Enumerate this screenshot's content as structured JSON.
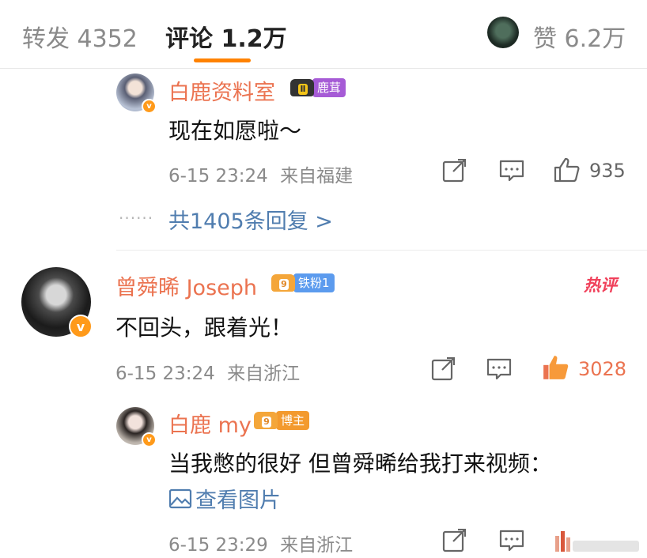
{
  "tabs": {
    "forward_label": "转发 4352",
    "comments_label": "评论 1.2万",
    "likes_label": "赞 6.2万"
  },
  "colors": {
    "accent": "#ff8200",
    "username": "#eb7350",
    "link": "#507daf",
    "like_active": "#eb7350",
    "hot": "#f0405a"
  },
  "comments": [
    {
      "username": "白鹿资料室",
      "badge_label": "鹿茸",
      "text": "现在如愿啦～",
      "time": "6-15 23:24",
      "location": "来自福建",
      "like_count": "935"
    },
    {
      "reply_link": "共1405条回复 >"
    },
    {
      "username": "曾舜晞 Joseph",
      "badge_label": "铁粉1",
      "hot_tag": "热评",
      "text": "不回头，跟着光！",
      "time": "6-15 23:24",
      "location": "来自浙江",
      "like_count": "3028"
    },
    {
      "username": "白鹿 my",
      "badge_label": "博主",
      "text": "当我憋的很好 但曾舜晞给我打来视频：",
      "image_link": "查看图片",
      "time": "6-15 23:29",
      "location": "来自浙江"
    }
  ]
}
